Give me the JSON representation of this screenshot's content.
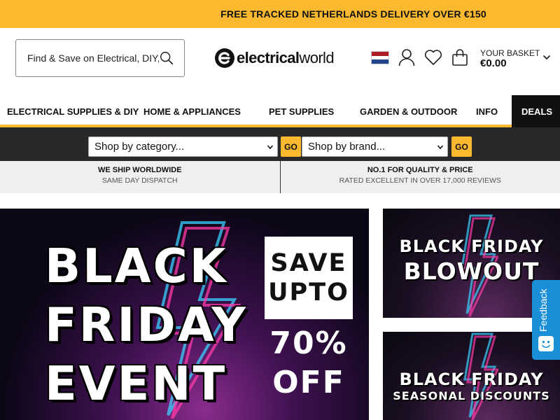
{
  "promo": {
    "text": "FREE TRACKED NETHERLANDS DELIVERY OVER €150"
  },
  "header": {
    "search_placeholder": "Find & Save on Electrical, DIY, Home & more...",
    "logo_text_bold": "electrical",
    "logo_text_light": "world",
    "flag": {
      "name": "netherlands-flag",
      "colors": [
        "#ae1c28",
        "#ffffff",
        "#21468b"
      ]
    },
    "basket": {
      "label": "YOUR BASKET",
      "total": "€0.00"
    }
  },
  "nav": {
    "items": [
      {
        "label": "ELECTRICAL SUPPLIES & DIY"
      },
      {
        "label": "HOME & APPLIANCES"
      },
      {
        "label": "PET SUPPLIES"
      },
      {
        "label": "GARDEN & OUTDOOR"
      },
      {
        "label": "INFO"
      },
      {
        "label": "DEALS"
      }
    ]
  },
  "filters": {
    "category_select": "Shop by category...",
    "brand_select": "Shop by brand...",
    "go_label": "GO"
  },
  "usp": [
    {
      "title": "WE SHIP WORLDWIDE",
      "sub": "SAME DAY DISPATCH"
    },
    {
      "title": "NO.1 FOR QUALITY & PRICE",
      "sub": "RATED EXCELLENT IN OVER 17,000 REVIEWS"
    }
  ],
  "banners": {
    "main": {
      "line1": "BLACK",
      "line2": "FRIDAY",
      "line3": "EVENT",
      "save1": "SAVE",
      "save2": "UPTO",
      "pct": "70%",
      "off": "OFF"
    },
    "side1": {
      "line1": "BLACK FRIDAY",
      "line2": "BLOWOUT"
    },
    "side2": {
      "line1": "BLACK FRIDAY",
      "line2": "SEASONAL DISCOUNTS"
    }
  },
  "feedback": {
    "label": "Feedback"
  },
  "colors": {
    "accent": "#fbb92f",
    "dark_bar": "#292929",
    "feedback_blue": "#1a8fd8"
  }
}
